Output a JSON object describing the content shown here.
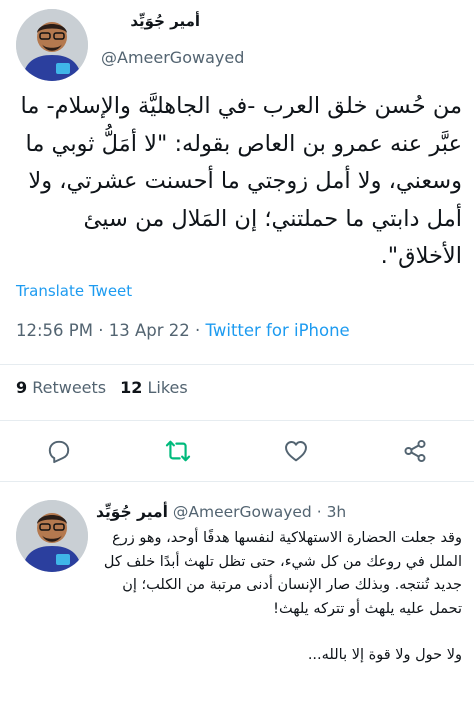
{
  "tweet": {
    "author_name": "أمير جُوَيِّد",
    "author_handle": "@AmeerGowayed",
    "text": "من حُسن خلق العرب -في الجاهليَّة والإسلام- ما عبَّر عنه عمرو بن العاص بقوله: \"لا أمَلُّ ثوبي ما وسعني، ولا أمل زوجتي ما أحسنت عشرتي، ولا أمل دابتي ما حملتني؛ إن المَلال من سيئ الأخلاق\".",
    "translate_label": "Translate Tweet",
    "time": "12:56 PM",
    "date": "13 Apr 22",
    "separator": "·",
    "source": "Twitter for iPhone"
  },
  "stats": {
    "retweets_count": "9",
    "retweets_label": "Retweets",
    "likes_count": "12",
    "likes_label": "Likes"
  },
  "actions": {
    "icons": [
      "reply-icon",
      "retweet-icon",
      "like-icon",
      "share-icon"
    ],
    "retweet_color": "#00ba7c"
  },
  "reply": {
    "author_name": "أمير جُوَيِّد",
    "author_handle": "@AmeerGowayed",
    "separator": "·",
    "time": "3h",
    "text": "وقد جعلت الحضارة الاستهلاكية لنفسها هدفًا أوحد، وهو زرع الملل في روعك من كل شيء، حتى تظل تلهث أبدًا خلف كل جديد تُنتجه. وبذلك صار الإنسان أدنى مرتبة من الكلب؛ إن تحمل عليه يلهث أو تتركه يلهث!",
    "closing": "ولا حول ولا قوة إلا بالله..."
  },
  "colors": {
    "link": "#1d9bf0",
    "secondary_text": "#536471",
    "primary_text": "#0f1419",
    "divider": "#e6ecf0"
  }
}
